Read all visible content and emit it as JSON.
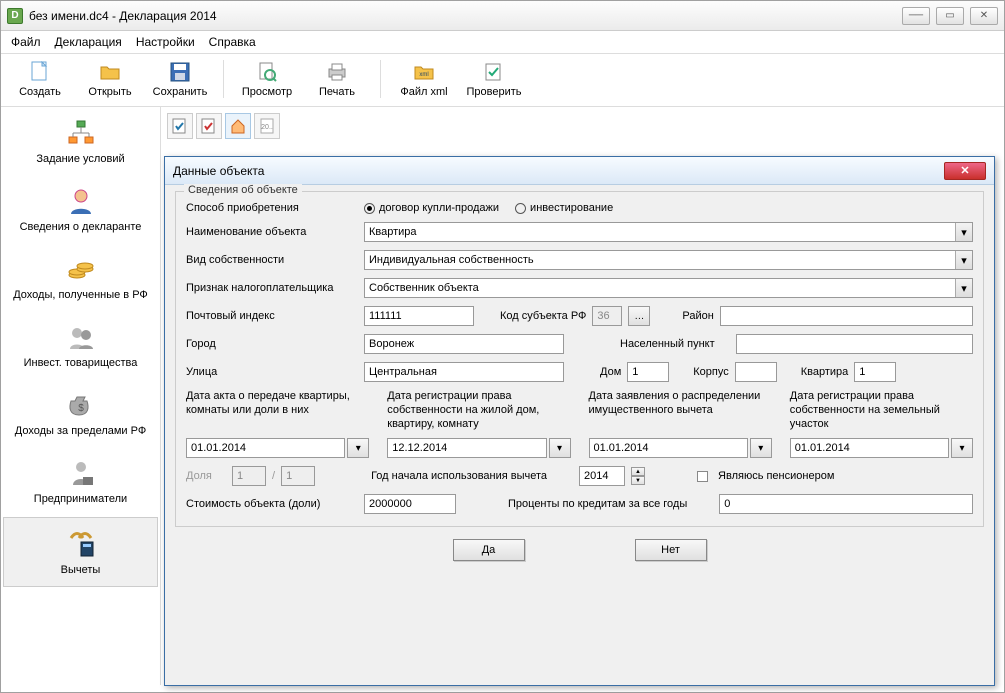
{
  "window": {
    "title": "без имени.dc4 - Декларация 2014"
  },
  "menu": {
    "file": "Файл",
    "decl": "Декларация",
    "settings": "Настройки",
    "help": "Справка"
  },
  "toolbar": {
    "create": "Создать",
    "open": "Открыть",
    "save": "Сохранить",
    "preview": "Просмотр",
    "print": "Печать",
    "xml": "Файл xml",
    "check": "Проверить"
  },
  "sidebar": {
    "conditions": "Задание условий",
    "declarant": "Сведения о декларанте",
    "income": "Доходы, полученные в РФ",
    "invest": "Инвест. товарищества",
    "abroad": "Доходы за пределами РФ",
    "business": "Предприниматели",
    "deductions": "Вычеты"
  },
  "mini": {
    "doc": "20.."
  },
  "dialog": {
    "title": "Данные объекта",
    "legend": "Сведения об объекте",
    "acquisition_label": "Способ приобретения",
    "radio_purchase": "договор купли-продажи",
    "radio_invest": "инвестирование",
    "name_label": "Наименование объекта",
    "name_value": "Квартира",
    "ownership_label": "Вид собственности",
    "ownership_value": "Индивидуальная собственность",
    "taxpayer_label": "Признак налогоплательщика",
    "taxpayer_value": "Собственник объекта",
    "postal_label": "Почтовый индекс",
    "postal_value": "111111",
    "region_code_label": "Код субъекта РФ",
    "region_code_value": "36",
    "district_label": "Район",
    "district_value": "",
    "city_label": "Город",
    "city_value": "Воронеж",
    "locality_label": "Населенный пункт",
    "locality_value": "",
    "street_label": "Улица",
    "street_value": "Центральная",
    "house_label": "Дом",
    "house_value": "1",
    "block_label": "Корпус",
    "block_value": "",
    "apt_label": "Квартира",
    "apt_value": "1",
    "date_act_label": "Дата акта о передаче квартиры, комнаты или доли в них",
    "date_reg_label": "Дата регистрации права собственности на жилой дом, квартиру, комнату",
    "date_claim_label": "Дата заявления о распределении имущественного вычета",
    "date_land_label": "Дата регистрации права собственности на земельный участок",
    "date_act_value": "01.01.2014",
    "date_reg_value": "12.12.2014",
    "date_claim_value": "01.01.2014",
    "date_land_value": "01.01.2014",
    "share_label": "Доля",
    "share_num": "1",
    "share_div": "/",
    "share_den": "1",
    "year_label": "Год начала использования вычета",
    "year_value": "2014",
    "pensioner_label": "Являюсь пенсионером",
    "cost_label": "Стоимость объекта (доли)",
    "cost_value": "2000000",
    "interest_label": "Проценты по кредитам за все годы",
    "interest_value": "0",
    "ok": "Да",
    "cancel": "Нет"
  }
}
